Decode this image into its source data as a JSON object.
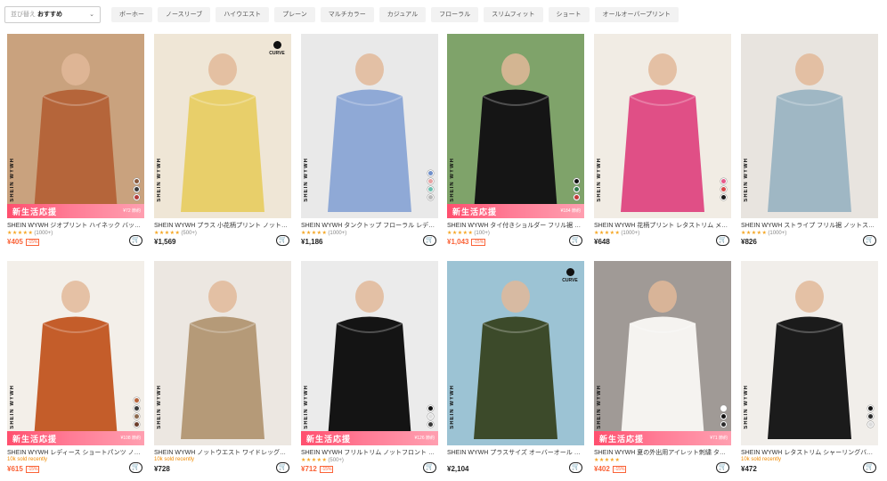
{
  "filter": {
    "sort_label": "並び替え",
    "sort_value": "おすすめ",
    "chips": [
      "ボーホー",
      "ノースリーブ",
      "ハイウエスト",
      "プレーン",
      "マルチカラー",
      "カジュアル",
      "フローラル",
      "スリムフィット",
      "ショート",
      "オールオーバープリント"
    ]
  },
  "products": [
    {
      "title": "SHEIN WYWH ジオプリント ハイネック バッ…",
      "price": "¥405",
      "discount": "-15%",
      "rating": "★★★★★",
      "reviews": "(1000+)",
      "promo_text": "新生活応援",
      "promo_price": "¥72 節約",
      "curve": false,
      "swatches": [
        "#8a5a3c",
        "#3b3b3b",
        "#b23b3b"
      ],
      "bg": "#c9a27e",
      "garment": "#b5653a"
    },
    {
      "title": "SHEIN WYWH プラス 小花柄プリント ノット…",
      "price": "¥1,569",
      "discount": "",
      "rating": "★★★★★",
      "reviews": "(500+)",
      "promo_text": "",
      "promo_price": "",
      "curve": true,
      "curve_text": "CURVE",
      "swatches": [],
      "bg": "#efe6d6",
      "garment": "#e8cf6a"
    },
    {
      "title": "SHEIN WYWH タンクトップ フローラル レデ…",
      "price": "¥1,186",
      "discount": "",
      "rating": "★★★★★",
      "reviews": "(1000+)",
      "promo_text": "",
      "promo_price": "",
      "curve": false,
      "swatches": [
        "#6f8fc9",
        "#e7a1a1",
        "#6bbfb0",
        "#b8b8b8"
      ],
      "bg": "#e9e9e9",
      "garment": "#8fa9d6"
    },
    {
      "title": "SHEIN WYWH タイ付きショルダー フリル裾 …",
      "price": "¥1,043",
      "discount": "-15%",
      "rating": "★★★★★",
      "reviews": "(100+)",
      "promo_text": "新生活応援",
      "promo_price": "¥184 節約",
      "curve": false,
      "swatches": [
        "#111111",
        "#2f7a4a",
        "#c23a3a"
      ],
      "bg": "#7fa36a",
      "garment": "#151515"
    },
    {
      "title": "SHEIN WYWH 花柄プリント レタストリム メ…",
      "price": "¥648",
      "discount": "",
      "rating": "★★★★★",
      "reviews": "(1000+)",
      "promo_text": "",
      "promo_price": "",
      "curve": false,
      "swatches": [
        "#e65a8a",
        "#d84848",
        "#1a1a1a"
      ],
      "bg": "#f1ece4",
      "garment": "#e04f86"
    },
    {
      "title": "SHEIN WYWH ストライプ フリル裾 ノットス…",
      "price": "¥826",
      "discount": "",
      "rating": "★★★★★",
      "reviews": "(1000+)",
      "promo_text": "",
      "promo_price": "",
      "curve": false,
      "swatches": [],
      "bg": "#e8e4df",
      "garment": "#9fb7c4"
    },
    {
      "title": "SHEIN WYWH レディース ショートパンツ ノ…",
      "price": "¥615",
      "discount": "-15%",
      "rating": "",
      "reviews": "",
      "sold": "10k sold recently",
      "promo_text": "新生活応援",
      "promo_price": "¥108 節約",
      "curve": false,
      "swatches": [
        "#b8643a",
        "#3a3a3a",
        "#8c6a4f",
        "#6b3d2a"
      ],
      "bg": "#f3efe9",
      "garment": "#c45d2a"
    },
    {
      "title": "SHEIN WYWH ノットウエスト ワイドレッグ…",
      "price": "¥728",
      "discount": "",
      "rating": "",
      "reviews": "",
      "sold": "10k sold recently",
      "promo_text": "",
      "promo_price": "",
      "curve": false,
      "swatches": [],
      "bg": "#ece7e1",
      "garment": "#b59a78"
    },
    {
      "title": "SHEIN WYWH フリルトリム ノットフロント …",
      "price": "¥712",
      "discount": "-15%",
      "rating": "★★★★★",
      "reviews": "(500+)",
      "promo_text": "新生活応援",
      "promo_price": "¥126 節約",
      "curve": false,
      "swatches": [
        "#111111",
        "#e0e0e0",
        "#3a3a3a"
      ],
      "bg": "#ebebeb",
      "garment": "#141414"
    },
    {
      "title": "SHEIN WYWH プラスサイズ オーバーオール …",
      "price": "¥2,104",
      "discount": "",
      "rating": "",
      "reviews": "",
      "promo_text": "",
      "promo_price": "",
      "curve": true,
      "curve_text": "CURVE",
      "swatches": [],
      "bg": "#9cc3d4",
      "garment": "#3c4a2a"
    },
    {
      "title": "SHEIN WYWH 夏の外出用アイレット刺繍 タ…",
      "price": "¥402",
      "discount": "-15%",
      "rating": "★★★★★",
      "reviews": "",
      "sold": "10k sold recently",
      "promo_text": "新生活応援",
      "promo_price": "¥71 節約",
      "curve": false,
      "swatches": [
        "#ffffff",
        "#111111",
        "#2a2a2a"
      ],
      "bg": "#a09a96",
      "garment": "#f5f3f0"
    },
    {
      "title": "SHEIN WYWH レタストリム シャーリングバ…",
      "price": "¥472",
      "discount": "",
      "rating": "",
      "reviews": "",
      "sold": "10k sold recently",
      "promo_text": "",
      "promo_price": "",
      "curve": false,
      "swatches": [
        "#111111",
        "#2b2b2b",
        "#dcdcdc"
      ],
      "bg": "#f1eeea",
      "garment": "#1b1b1b"
    }
  ],
  "brand_vertical": "SHEIN WYWH",
  "cart_icon": "cart-plus-icon",
  "colors": {
    "sale_price": "#fa6338",
    "promo_start": "#ff4f6e",
    "star": "#f5a623"
  }
}
